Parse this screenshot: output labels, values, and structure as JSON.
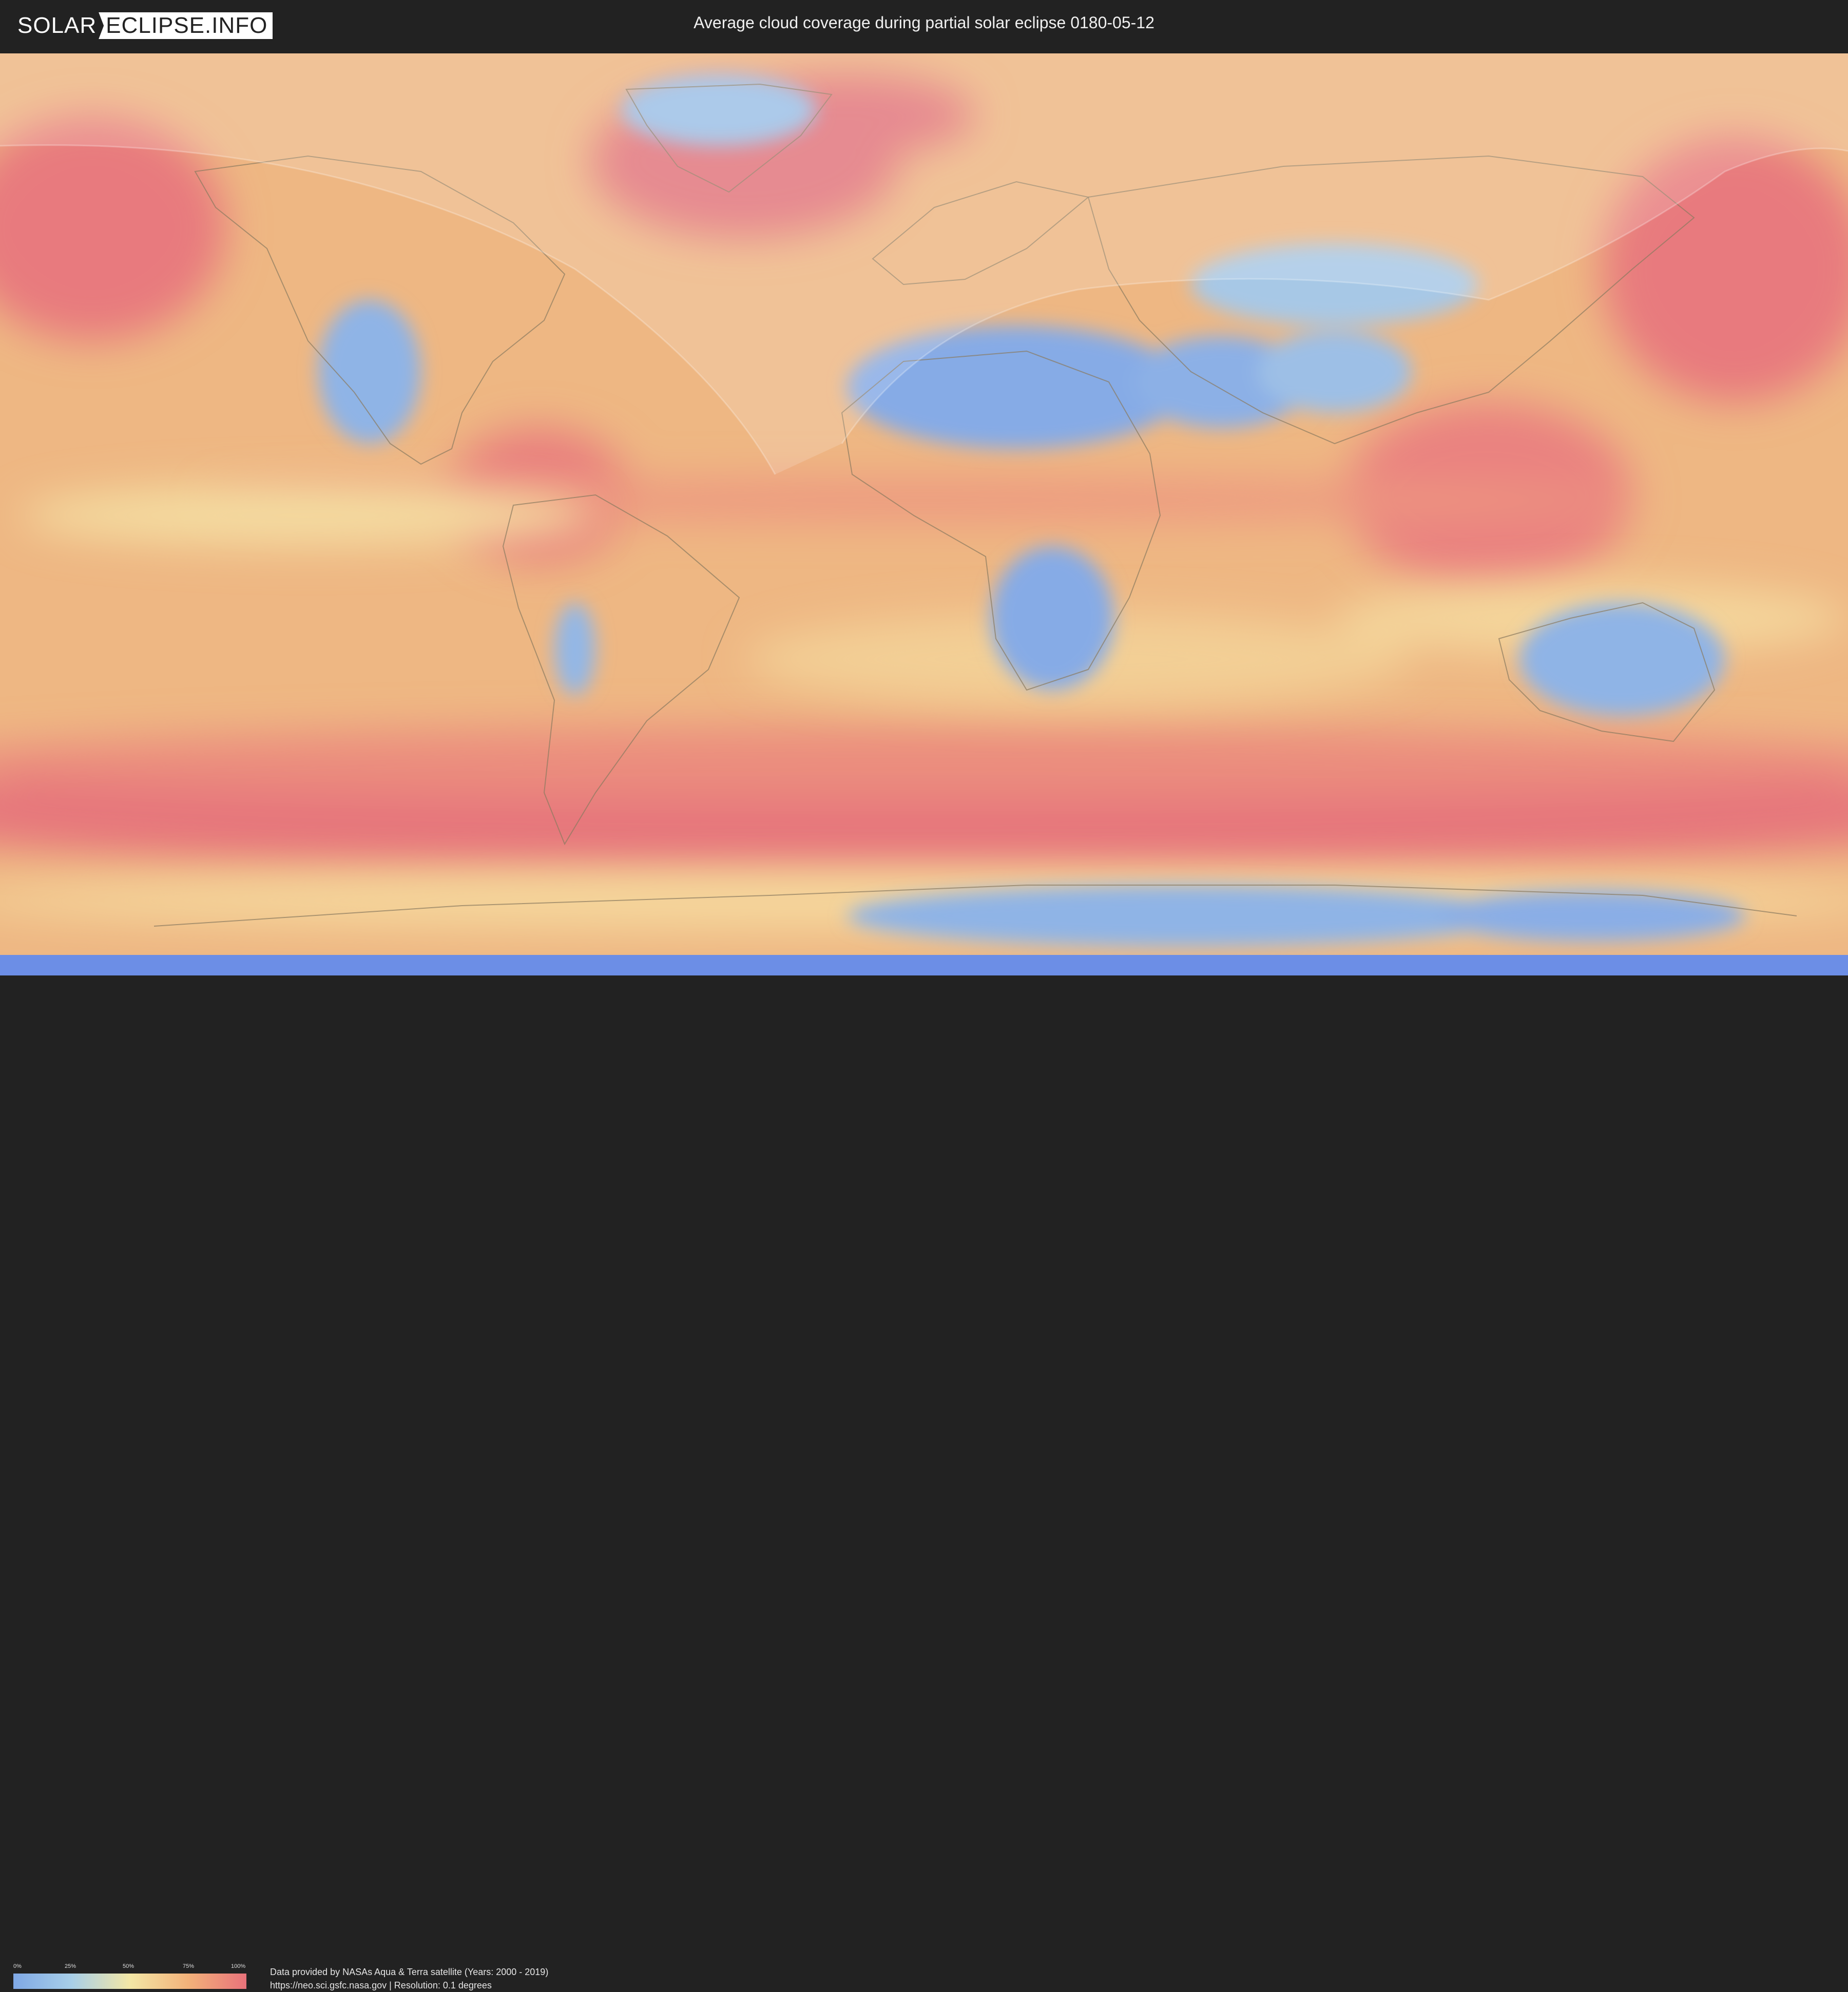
{
  "header": {
    "logo_left": "SOLAR",
    "logo_right": "ECLIPSE.INFO",
    "title": "Average cloud coverage during partial solar eclipse 0180-05-12"
  },
  "legend": {
    "ticks": [
      "0%",
      "25%",
      "50%",
      "75%",
      "100%"
    ],
    "colors": {
      "low": "#7fa8e6",
      "mid_low": "#a8cfe8",
      "mid": "#f3e7a6",
      "mid_high": "#f3b27a",
      "high": "#e8727a"
    }
  },
  "credits": {
    "line1": "Data provided by NASAs Aqua & Terra satellite (Years: 2000 - 2019)",
    "line2": "https://neo.sci.gsfc.nasa.gov | Resolution: 0.1 degrees"
  },
  "map": {
    "background_color": "#e9b97f",
    "eclipse_shadow_color": "#ffffff",
    "land_outline_color": "#8a7a60"
  }
}
